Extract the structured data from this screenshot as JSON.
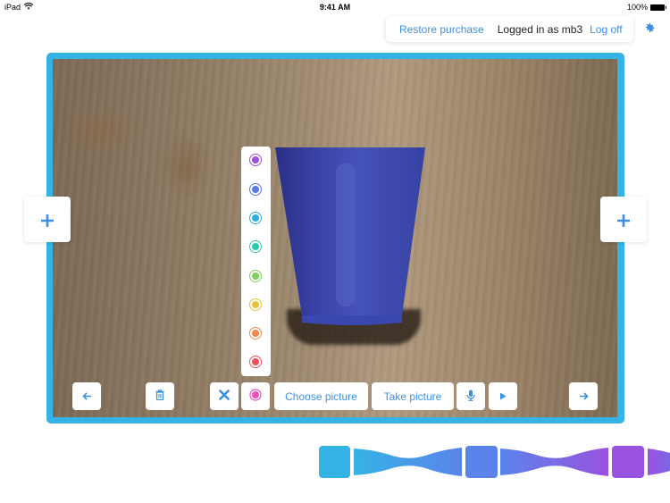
{
  "status_bar": {
    "device": "iPad",
    "time": "9:41 AM",
    "battery": "100%"
  },
  "account": {
    "restore_purchase": "Restore purchase",
    "logged_in_text": "Logged in as mb3",
    "log_off": "Log off",
    "settings_icon": "gear-icon"
  },
  "editor": {
    "add_left_icon": "plus-icon",
    "add_right_icon": "plus-icon",
    "photo_subject": "blue plastic cup on wooden table",
    "palette_colors": [
      "#9b4fe0",
      "#5a78e8",
      "#2eaee0",
      "#2ec9a8",
      "#7ed05a",
      "#e8c33a",
      "#f08a4a",
      "#f0505a"
    ],
    "selected_color": "#f050b8"
  },
  "toolbar": {
    "prev_icon": "arrow-left-icon",
    "delete_icon": "trash-icon",
    "close_icon": "close-icon",
    "color_icon": "color-dot-icon",
    "choose_picture": "Choose picture",
    "take_picture": "Take picture",
    "mic_icon": "microphone-icon",
    "play_icon": "play-icon",
    "next_icon": "arrow-right-icon"
  },
  "timeline": {
    "frames": [
      {
        "color": "#35b3e6",
        "selected": true
      },
      {
        "color": "#5a84ea",
        "selected": false
      },
      {
        "color": "#9a52e0",
        "selected": false
      }
    ]
  }
}
